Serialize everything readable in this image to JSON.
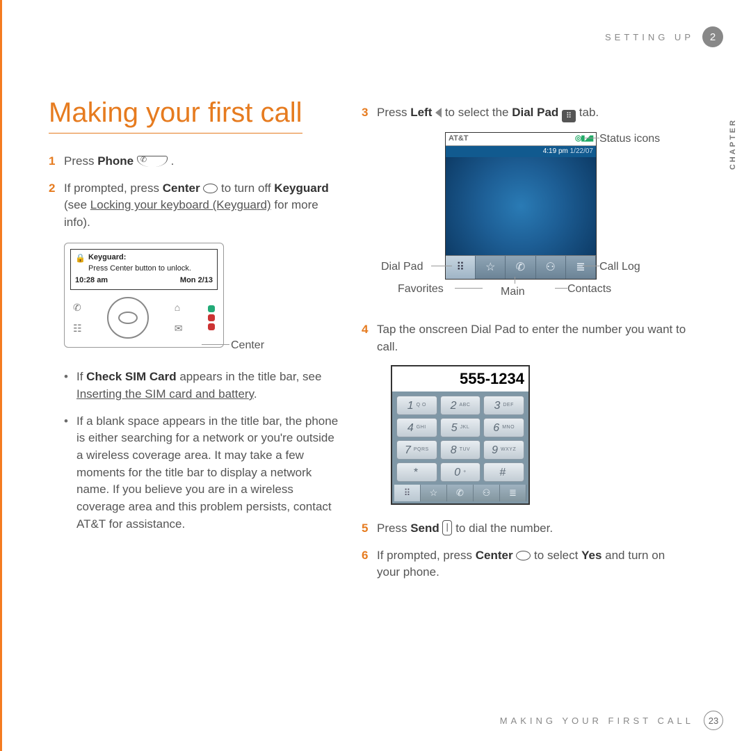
{
  "header": {
    "section": "SETTING UP",
    "chapter_num": "2",
    "chapter_word": "CHAPTER"
  },
  "title": "Making your first call",
  "left": {
    "step1": {
      "n": "1",
      "t1": "Press ",
      "b1": "Phone"
    },
    "step2": {
      "n": "2",
      "t1": "If prompted, press ",
      "b1": "Center",
      "t2": " to turn off ",
      "b2": "Keyguard",
      "t3": " (see ",
      "link": "Locking your keyboard (Keyguard)",
      "t4": " for more info)."
    },
    "fig1": {
      "kg_title": "Keyguard:",
      "kg_line": "Press Center button to unlock.",
      "time": "10:28 am",
      "date": "Mon 2/13",
      "center_label": "Center"
    },
    "bullet1": {
      "t1": "If ",
      "b1": "Check SIM Card",
      "t2": " appears in the title bar, see ",
      "link": "Inserting the SIM card and battery",
      "t3": "."
    },
    "bullet2": "If a blank space appears in the title bar, the phone is either searching for a network or you're outside a wireless coverage area. It may take a few moments for the title bar to display a network name. If you believe you are in a wireless coverage area and this problem persists, contact AT&T for assistance."
  },
  "right": {
    "step3": {
      "n": "3",
      "t1": "Press ",
      "b1": "Left",
      "t2": " to select the ",
      "b2": "Dial Pad",
      "t3": " tab."
    },
    "fig2": {
      "carrier": "AT&T",
      "status_icons": "◎▮◢▮",
      "time": "4:19 pm",
      "date": "1/22/07",
      "callouts": {
        "status": "Status icons",
        "dialpad": "Dial Pad",
        "calllog": "Call Log",
        "fav": "Favorites",
        "main": "Main",
        "contacts": "Contacts"
      },
      "tab_icons": [
        "⠿",
        "☆",
        "✆",
        "⚇",
        "≣"
      ]
    },
    "step4": {
      "n": "4",
      "t": "Tap the onscreen Dial Pad to enter the number you want to call."
    },
    "fig3": {
      "display": "555-1234",
      "keys": [
        {
          "n": "1",
          "l": "Q O"
        },
        {
          "n": "2",
          "l": "ABC"
        },
        {
          "n": "3",
          "l": "DEF"
        },
        {
          "n": "4",
          "l": "GHI"
        },
        {
          "n": "5",
          "l": "JKL"
        },
        {
          "n": "6",
          "l": "MNO"
        },
        {
          "n": "7",
          "l": "PQRS"
        },
        {
          "n": "8",
          "l": "TUV"
        },
        {
          "n": "9",
          "l": "WXYZ"
        },
        {
          "n": "*",
          "l": ""
        },
        {
          "n": "0",
          "l": "+"
        },
        {
          "n": "#",
          "l": ""
        }
      ],
      "tab_icons": [
        "⠿",
        "☆",
        "✆",
        "⚇",
        "≣"
      ]
    },
    "step5": {
      "n": "5",
      "t1": "Press ",
      "b1": "Send",
      "t2": " to dial the number."
    },
    "step6": {
      "n": "6",
      "t1": "If prompted, press ",
      "b1": "Center",
      "t2": " to select ",
      "b2": "Yes",
      "t3": " and turn on your phone."
    }
  },
  "footer": {
    "section": "MAKING YOUR FIRST CALL",
    "page": "23"
  }
}
